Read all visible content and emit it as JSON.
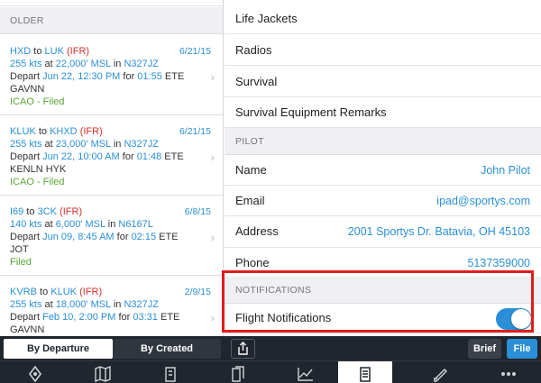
{
  "left": {
    "section_label": "OLDER",
    "flights": [
      {
        "from": "HXD",
        "to_word": "to",
        "dest": "LUK",
        "rules": "(IFR)",
        "date": "6/21/15",
        "speed": "255 kts",
        "at": "at",
        "alt": "22,000' MSL",
        "in": "in",
        "tail": "N327JZ",
        "depart_word": "Depart",
        "depart": "Jun 22, 12:30 PM",
        "for": "for",
        "ete": "01:55",
        "ete_word": "ETE",
        "route": "GAVNN",
        "status": "ICAO - Filed"
      },
      {
        "from": "KLUK",
        "to_word": "to",
        "dest": "KHXD",
        "rules": "(IFR)",
        "date": "6/21/15",
        "speed": "255 kts",
        "at": "at",
        "alt": "23,000' MSL",
        "in": "in",
        "tail": "N327JZ",
        "depart_word": "Depart",
        "depart": "Jun 22, 10:00 AM",
        "for": "for",
        "ete": "01:48",
        "ete_word": "ETE",
        "route": "KENLN HYK",
        "status": "ICAO - Filed"
      },
      {
        "from": "I69",
        "to_word": "to",
        "dest": "3CK",
        "rules": "(IFR)",
        "date": "6/8/15",
        "speed": "140 kts",
        "at": "at",
        "alt": "6,000' MSL",
        "in": "in",
        "tail": "N6167L",
        "depart_word": "Depart",
        "depart": "Jun 09, 8:45 AM",
        "for": "for",
        "ete": "02:15",
        "ete_word": "ETE",
        "route": "JOT",
        "status": "Filed"
      },
      {
        "from": "KVRB",
        "to_word": "to",
        "dest": "KLUK",
        "rules": "(IFR)",
        "date": "2/9/15",
        "speed": "255 kts",
        "at": "at",
        "alt": "18,000' MSL",
        "in": "in",
        "tail": "N327JZ",
        "depart_word": "Depart",
        "depart": "Feb 10, 2:00 PM",
        "for": "for",
        "ete": "03:31",
        "ete_word": "ETE",
        "route": "GAVNN",
        "status": ""
      }
    ]
  },
  "right": {
    "survival_rows": [
      "Life Jackets",
      "Radios",
      "Survival",
      "Survival Equipment Remarks"
    ],
    "pilot_section": "PILOT",
    "pilot": {
      "name_label": "Name",
      "name_value": "John Pilot",
      "email_label": "Email",
      "email_value": "ipad@sportys.com",
      "address_label": "Address",
      "address_value": "2001 Sportys Dr. Batavia, OH 45103",
      "phone_label": "Phone",
      "phone_value": "5137359000"
    },
    "notifications_section": "NOTIFICATIONS",
    "flight_notifications_label": "Flight Notifications",
    "flight_notifications_on": true
  },
  "toolbar": {
    "sort_departure": "By Departure",
    "sort_created": "By Created",
    "share_icon": "share-icon",
    "brief_label": "Brief",
    "file_label": "File"
  },
  "tabbar": {
    "tabs": [
      "airport-icon",
      "map-icon",
      "procedures-icon",
      "documents-icon",
      "weather-graph-icon",
      "file-flight-plan-icon",
      "pen-icon",
      "more-icon"
    ],
    "active_index": 5
  },
  "colors": {
    "accent": "#2a8fd6",
    "ifr_red": "#d0312d",
    "filed_green": "#5aa53a",
    "toolbar": "#20262d",
    "highlight": "#e21c1c"
  }
}
